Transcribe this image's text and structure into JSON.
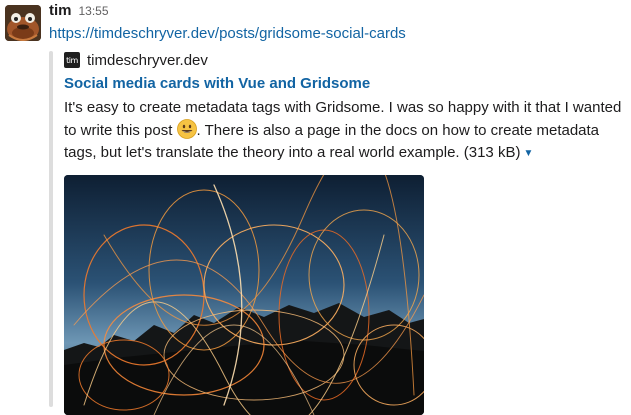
{
  "message": {
    "sender": "tim",
    "timestamp": "13:55",
    "link": "https://timdeschryver.dev/posts/gridsome-social-cards"
  },
  "attachment": {
    "service_icon_text": "tim",
    "service_name": "timdeschryver.dev",
    "title": "Social media cards with Vue and Gridsome",
    "text_part1": "It's easy to create metadata tags with Gridsome. I was so happy with it that I wanted to write this post ",
    "emoji": "smiley-emoji",
    "text_part2": ". There is also a page in the docs on how to create metadata tags, but let's translate the theory into a real world example.",
    "size": "(313 kB)",
    "expand_icon": "caret-down-icon",
    "accent_bar_color": "#dddddd",
    "link_color": "#1264a3"
  }
}
